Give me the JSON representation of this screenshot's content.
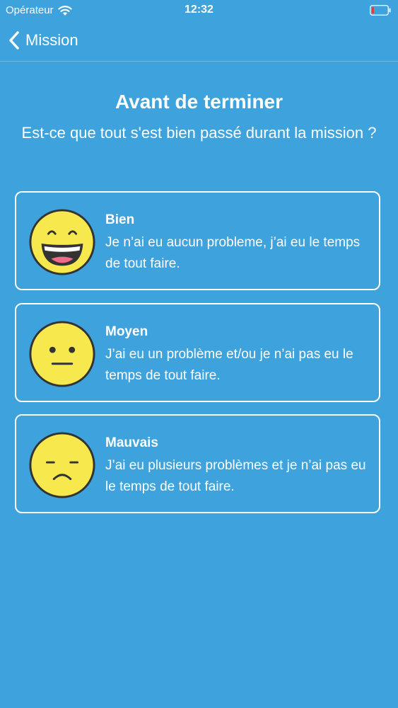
{
  "status_bar": {
    "carrier": "Opérateur",
    "time": "12:32",
    "battery_color": "#e0403a"
  },
  "nav": {
    "back_label": "Mission"
  },
  "header": {
    "title": "Avant de terminer",
    "subtitle": "Est-ce que tout s'est bien passé durant la mission ?"
  },
  "options": [
    {
      "icon": "happy-face-icon",
      "title": "Bien",
      "description": "Je n’ai eu aucun probleme, j’ai eu le temps de tout faire."
    },
    {
      "icon": "neutral-face-icon",
      "title": "Moyen",
      "description": "J’ai eu un problème et/ou je n’ai pas eu le temps de tout faire."
    },
    {
      "icon": "sad-face-icon",
      "title": "Mauvais",
      "description": "J’ai eu plusieurs problèmes et je n’ai pas eu le temps de tout faire."
    }
  ],
  "colors": {
    "background": "#3ea3dd",
    "face": "#f7e84d",
    "face_outline": "#333333"
  }
}
